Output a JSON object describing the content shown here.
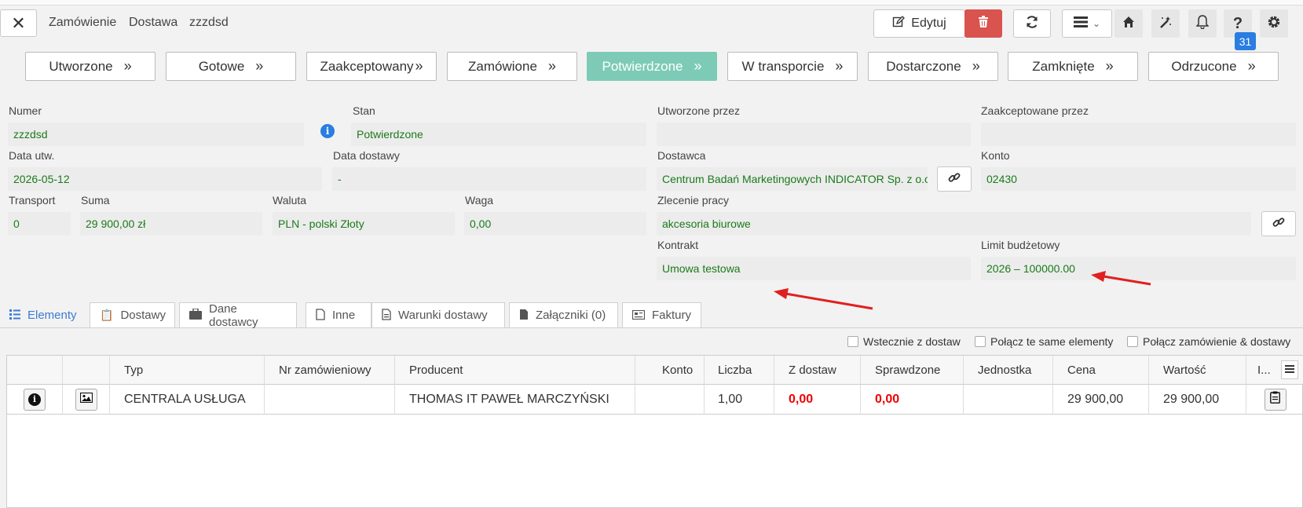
{
  "header": {
    "breadcrumb": [
      "Zamówienie",
      "Dostawa",
      "zzzdsd"
    ],
    "edit_label": "Edytuj",
    "notifications_count": "31",
    "icons": [
      "close-icon",
      "pencil-icon",
      "trash-icon",
      "refresh-icon",
      "menu-icon",
      "home-icon",
      "magic-wand-icon",
      "bell-icon",
      "help-icon",
      "gear-icon"
    ]
  },
  "stages": [
    {
      "label": "Utworzone"
    },
    {
      "label": "Gotowe"
    },
    {
      "label": "Zaakceptowany"
    },
    {
      "label": "Zamówione"
    },
    {
      "label": "Potwierdzone",
      "active": true
    },
    {
      "label": "W transporcie"
    },
    {
      "label": "Dostarczone"
    },
    {
      "label": "Zamknięte"
    },
    {
      "label": "Odrzucone"
    }
  ],
  "form": {
    "numer": {
      "label": "Numer",
      "value": "zzzdsd"
    },
    "stan": {
      "label": "Stan",
      "value": "Potwierdzone"
    },
    "utworzone_przez": {
      "label": "Utworzone przez",
      "value": ""
    },
    "zaakceptowane_przez": {
      "label": "Zaakceptowane przez",
      "value": ""
    },
    "data_utw": {
      "label": "Data utw.",
      "value": "2026-05-12"
    },
    "data_dostawy": {
      "label": "Data dostawy",
      "value": "-"
    },
    "dostawca": {
      "label": "Dostawca",
      "value": "Centrum Badań Marketingowych INDICATOR Sp. z o.o."
    },
    "konto": {
      "label": "Konto",
      "value": "02430"
    },
    "transport": {
      "label": "Transport",
      "value": "0"
    },
    "suma": {
      "label": "Suma",
      "value": "29 900,00 zł"
    },
    "waluta": {
      "label": "Waluta",
      "value": "PLN - polski Złoty"
    },
    "waga": {
      "label": "Waga",
      "value": "0,00"
    },
    "zlecenie": {
      "label": "Zlecenie pracy",
      "value": "akcesoria biurowe"
    },
    "kontrakt": {
      "label": "Kontrakt",
      "value": "Umowa testowa"
    },
    "limit": {
      "label": "Limit budżetowy",
      "value": "2026 – 100000.00"
    }
  },
  "tabs": [
    {
      "label": "Elementy",
      "icon": "list-icon",
      "active": true
    },
    {
      "label": "Dostawy",
      "icon": "clipboard-icon"
    },
    {
      "label": "Dane dostawcy",
      "icon": "briefcase-icon"
    },
    {
      "label": "Inne",
      "icon": "file-icon"
    },
    {
      "label": "Warunki dostawy",
      "icon": "document-icon"
    },
    {
      "label": "Załączniki (0)",
      "icon": "file-filled-icon"
    },
    {
      "label": "Faktury",
      "icon": "invoice-icon"
    }
  ],
  "options": [
    {
      "label": "Wstecznie z dostaw"
    },
    {
      "label": "Połącz te same elementy"
    },
    {
      "label": "Połącz zamówienie & dostawy"
    }
  ],
  "table": {
    "columns": [
      "Typ",
      "Nr zamówieniowy",
      "Producent",
      "Konto",
      "Liczba",
      "Z dostaw",
      "Sprawdzone",
      "Jednostka",
      "Cena",
      "Wartość",
      "I..."
    ],
    "rows": [
      {
        "typ": "CENTRALA USŁUGA",
        "nr": "",
        "producent": "THOMAS IT PAWEŁ MARCZYŃSKI",
        "konto": "",
        "liczba": "1,00",
        "z_dostaw": "0,00",
        "sprawdzone": "0,00",
        "jednostka": "",
        "cena": "29 900,00",
        "wartosc": "29 900,00"
      }
    ]
  },
  "colors": {
    "accent": "#3a7bd5",
    "active_stage": "#7dcbb6",
    "delete": "#d9534f",
    "value_text": "#1a7a1a",
    "annotation_arrow": "#e02020"
  }
}
